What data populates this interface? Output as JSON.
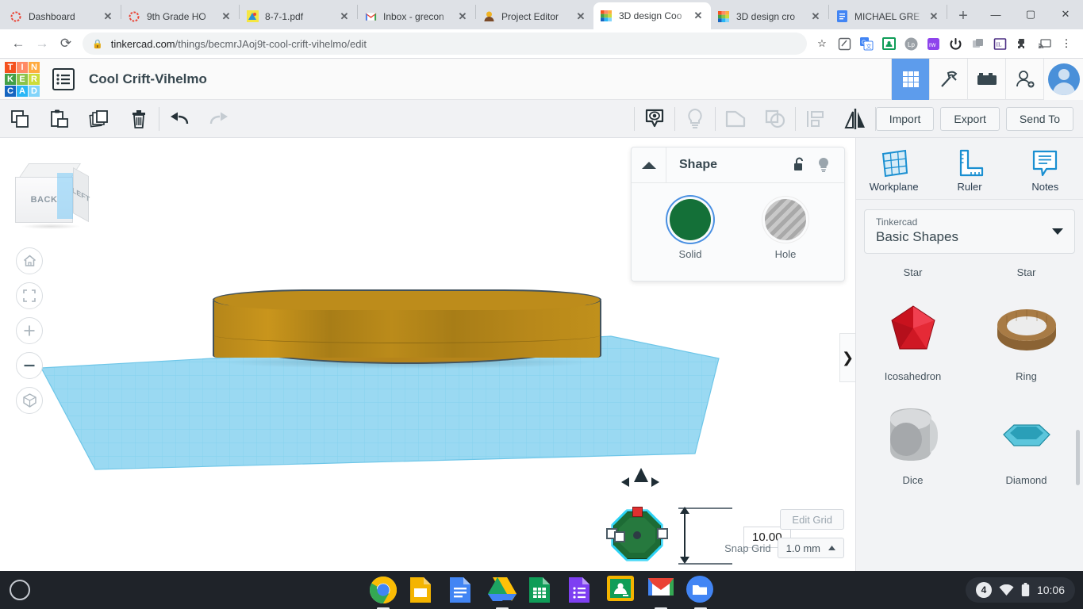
{
  "browser": {
    "tabs": [
      {
        "title": "Dashboard",
        "favicon": "tinkercad-ring-icon",
        "active": false
      },
      {
        "title": "9th Grade HO",
        "favicon": "tinkercad-ring-icon",
        "active": false
      },
      {
        "title": "8-7-1.pdf",
        "favicon": "pdf-icon",
        "active": false
      },
      {
        "title": "Inbox - grecon",
        "favicon": "gmail-icon",
        "active": false
      },
      {
        "title": "Project Editor",
        "favicon": "person-icon",
        "active": false
      },
      {
        "title": "3D design Coo",
        "favicon": "tinkercad-icon",
        "active": true
      },
      {
        "title": "3D design cro",
        "favicon": "tinkercad-icon",
        "active": false
      },
      {
        "title": "MICHAEL GRE",
        "favicon": "google-docs-icon",
        "active": false
      }
    ],
    "new_tab_label": "+",
    "close_label": "✕",
    "window_controls": [
      "minimize",
      "maximize",
      "close"
    ],
    "nav": {
      "back": "←",
      "forward": "→",
      "reload": "⟳"
    },
    "url_domain": "tinkercad.com",
    "url_path": "/things/becmrJAoj9t-cool-crift-vihelmo/edit",
    "lock_icon": "lock-icon",
    "star_icon": "bookmark-star-icon",
    "extensions": [
      "screencast-icon",
      "google-translate-icon",
      "google-classroom-icon",
      "lp-circle-icon",
      "purple-tw-icon",
      "power-icon",
      "grayscale-stack-icon",
      "il-book-icon",
      "puzzle-extensions-icon",
      "cast-icon",
      "chrome-menu-icon"
    ]
  },
  "tinkercad": {
    "logo_letters": [
      "T",
      "I",
      "N",
      "K",
      "E",
      "R",
      "C",
      "A",
      "D"
    ],
    "logo_colors": [
      "#f4511e",
      "#ff8a65",
      "#ffab40",
      "#43a047",
      "#8bc34a",
      "#cddc39",
      "#1565c0",
      "#29b6f6",
      "#81d4fa"
    ],
    "design_name": "Cool Crift-Vihelmo",
    "list_icon": "list-view-icon",
    "header_buttons": [
      {
        "name": "blocks-grid-icon",
        "selected": true
      },
      {
        "name": "codeblocks-hammer-icon",
        "selected": false
      },
      {
        "name": "brick-icon",
        "selected": false
      },
      {
        "name": "add-person-icon",
        "selected": false
      }
    ],
    "avatar": "user-avatar",
    "toolbar": {
      "left_tools": [
        "copy-icon",
        "paste-icon",
        "duplicate-icon",
        "delete-icon"
      ],
      "history_tools": [
        "undo-icon",
        "redo-icon"
      ],
      "center_tools": [
        "show-hide-icon",
        "light-bulb-icon",
        "group-icon",
        "ungroup-icon",
        "align-icon",
        "mirror-icon"
      ],
      "import_label": "Import",
      "export_label": "Export",
      "send_to_label": "Send To"
    },
    "shape_panel": {
      "title": "Shape",
      "collapse_icon": "collapse-triangle-icon",
      "lock_icon": "unlock-icon",
      "bulb_icon": "light-bulb-icon",
      "solid_label": "Solid",
      "hole_label": "Hole",
      "solid_color": "#147038",
      "selected": "Solid"
    },
    "viewport": {
      "viewcube_front_label": "BACK",
      "viewcube_right_label": "LEFT",
      "controls": [
        "home-view-icon",
        "fit-to-view-icon",
        "zoom-in-icon",
        "zoom-out-icon",
        "orthographic-view-icon"
      ],
      "edit_grid_label": "Edit Grid",
      "snap_grid_label": "Snap Grid",
      "snap_grid_value": "1.0 mm",
      "dimension_value": "10.00",
      "panel_toggle_icon": "chevron-right-icon"
    },
    "sidebar": {
      "tools": [
        {
          "label": "Workplane",
          "icon": "workplane-grid-icon"
        },
        {
          "label": "Ruler",
          "icon": "ruler-icon"
        },
        {
          "label": "Notes",
          "icon": "notes-icon"
        }
      ],
      "library_category": "Tinkercad",
      "library_name": "Basic Shapes",
      "dropdown_icon": "chevron-down-icon",
      "shapes": [
        {
          "label": "Star",
          "icon": "star-shape",
          "partial": true
        },
        {
          "label": "Star",
          "icon": "star-shape",
          "partial": true
        },
        {
          "label": "Icosahedron",
          "icon": "icosahedron-shape",
          "color": "#d32030"
        },
        {
          "label": "Ring",
          "icon": "ring-shape",
          "color": "#8b6334"
        },
        {
          "label": "Dice",
          "icon": "dice-shape",
          "color": "#a8abad"
        },
        {
          "label": "Diamond",
          "icon": "diamond-shape",
          "color": "#3fb0c6"
        }
      ]
    }
  },
  "shelf": {
    "launcher": "launcher-icon",
    "apps": [
      {
        "name": "chrome-icon",
        "running": true
      },
      {
        "name": "google-slides-icon",
        "running": false
      },
      {
        "name": "google-docs-icon",
        "running": false
      },
      {
        "name": "google-drive-icon",
        "running": true
      },
      {
        "name": "google-sheets-icon",
        "running": false
      },
      {
        "name": "google-forms-icon",
        "running": false
      },
      {
        "name": "google-classroom-icon",
        "running": false
      },
      {
        "name": "gmail-icon",
        "running": true
      },
      {
        "name": "files-icon",
        "running": true
      }
    ],
    "tray": {
      "notification_count": "4",
      "wifi_icon": "wifi-icon",
      "battery_icon": "battery-icon",
      "time": "10:06"
    }
  }
}
